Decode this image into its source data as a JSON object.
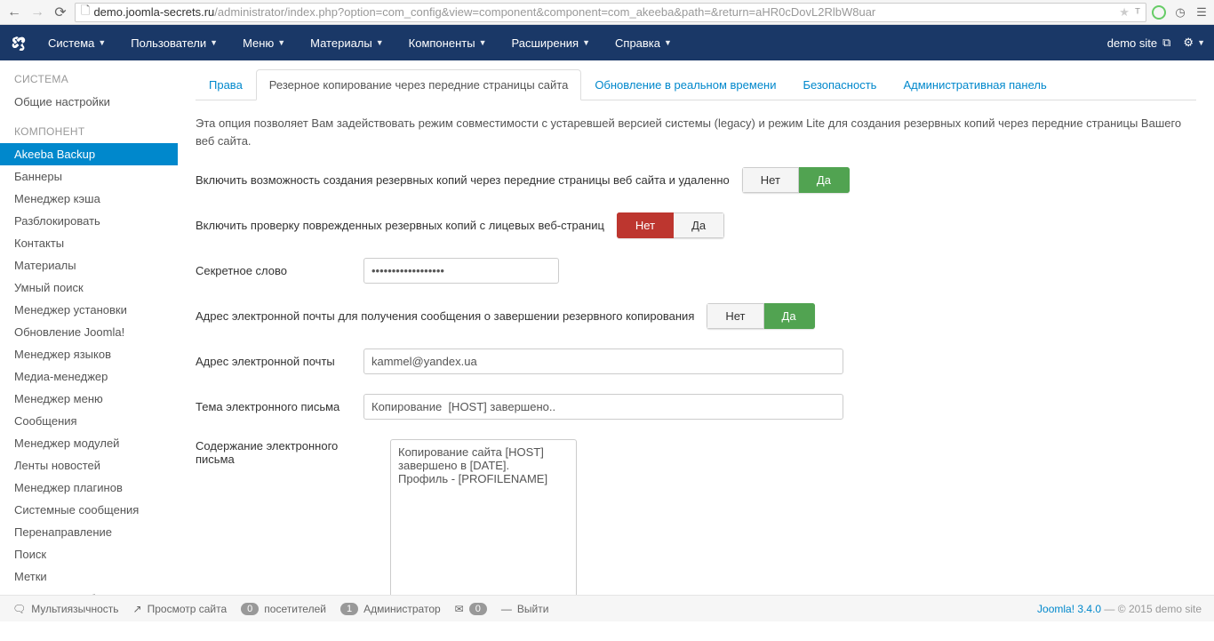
{
  "browser": {
    "url_host": "demo.joomla-secrets.ru",
    "url_path": "/administrator/index.php?option=com_config&view=component&component=com_akeeba&path=&return=aHR0cDovL2RlbW8uar"
  },
  "topnav": {
    "items": [
      "Система",
      "Пользователи",
      "Меню",
      "Материалы",
      "Компоненты",
      "Расширения",
      "Справка"
    ],
    "site_label": "demo site"
  },
  "sidebar": {
    "heading_system": "СИСТЕМА",
    "system_items": [
      "Общие настройки"
    ],
    "heading_component": "КОМПОНЕНТ",
    "component_items": [
      "Akeeba Backup",
      "Баннеры",
      "Менеджер кэша",
      "Разблокировать",
      "Контакты",
      "Материалы",
      "Умный поиск",
      "Менеджер установки",
      "Обновление Joomla!",
      "Менеджер языков",
      "Медиа-менеджер",
      "Менеджер меню",
      "Сообщения",
      "Менеджер модулей",
      "Ленты новостей",
      "Менеджер плагинов",
      "Системные сообщения",
      "Перенаправление",
      "Поиск",
      "Метки",
      "Менеджер шаблонов"
    ],
    "active_index": 0
  },
  "tabs": {
    "items": [
      "Права",
      "Резерное копирование через передние страницы сайта",
      "Обновление в реальном времени",
      "Безопасность",
      "Административная панель"
    ],
    "active_index": 1
  },
  "form": {
    "description": "Эта опция позволяет Вам задействовать режим совместимости с устаревшей версией системы (legacy) и режим Lite для создания резервных копий через передние страницы Вашего веб сайта.",
    "row1": {
      "label": "Включить возможность создания резервных копий через передние страницы веб сайта и удаленно",
      "no": "Нет",
      "yes": "Да",
      "value": "yes"
    },
    "row2": {
      "label": "Включить проверку поврежденных резервных копий с лицевых веб-страниц",
      "no": "Нет",
      "yes": "Да",
      "value": "no"
    },
    "row3": {
      "label": "Секретное слово",
      "value": "••••••••••••••••••"
    },
    "row4": {
      "label": "Адрес электронной почты для получения сообщения о завершении резервного копирования",
      "no": "Нет",
      "yes": "Да",
      "value": "yes"
    },
    "row5": {
      "label": "Адрес электронной почты",
      "value": "kammel@yandex.ua"
    },
    "row6": {
      "label": "Тема электронного письма",
      "value": "Копирование  [HOST] завершено.."
    },
    "row7": {
      "label": "Содержание электронного письма",
      "value": "Копирование сайта [HOST] завершено в [DATE].\nПрофиль - [PROFILENAME]"
    }
  },
  "footer": {
    "multilang": "Мультиязычность",
    "viewsite": "Просмотр сайта",
    "visitors_count": "0",
    "visitors_label": "посетителей",
    "admin_count": "1",
    "admin_label": "Администратор",
    "msg_count": "0",
    "logout": "Выйти",
    "right_version": "Joomla! 3.4.0",
    "right_sep": " — ",
    "right_copyright": "© 2015 demo site"
  }
}
